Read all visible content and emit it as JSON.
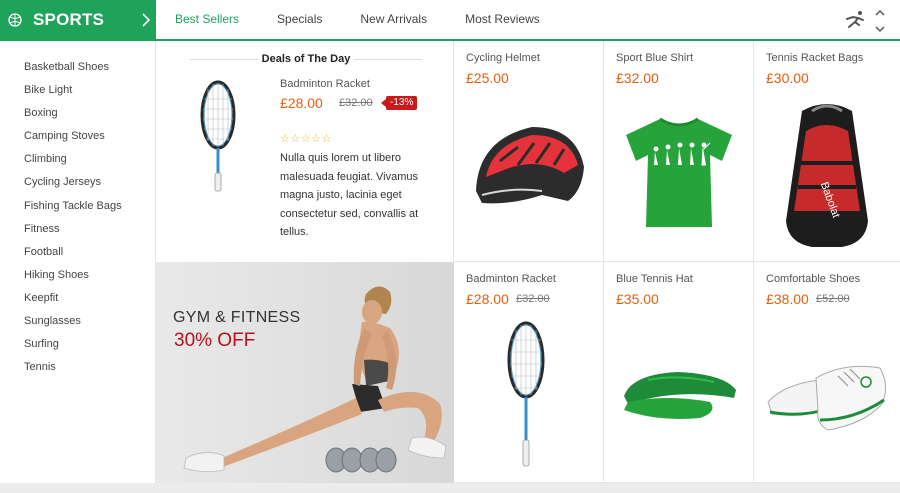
{
  "category": {
    "title": "SPORTS",
    "icon": "sports-ball-icon",
    "expand_icon": "chevron-right-icon"
  },
  "tabs": [
    {
      "label": "Best Sellers",
      "active": true
    },
    {
      "label": "Specials",
      "active": false
    },
    {
      "label": "New Arrivals",
      "active": false
    },
    {
      "label": "Most Reviews",
      "active": false
    }
  ],
  "header_icons": {
    "sport": "runner-icon",
    "nav": "up-down-arrows-icon"
  },
  "sidebar": {
    "items": [
      "Basketball Shoes",
      "Bike Light",
      "Boxing",
      "Camping Stoves",
      "Climbing",
      "Cycling Jerseys",
      "Fishing Tackle Bags",
      "Fitness",
      "Football",
      "Hiking Shoes",
      "Keepfit",
      "Sunglasses",
      "Surfing",
      "Tennis"
    ]
  },
  "deal": {
    "title": "Deals of The Day",
    "name": "Badminton Racket",
    "price": "£28.00",
    "old_price": "£32.00",
    "discount": "-13%",
    "rating": 0,
    "stars": "☆☆☆☆☆",
    "description": "Nulla quis lorem ut libero malesuada feugiat. Vivamus magna justo, lacinia eget consectetur sed, convallis at tellus."
  },
  "promo": {
    "line1": "GYM & FITNESS",
    "line2": "30% OFF"
  },
  "products": [
    {
      "name": "Cycling Helmet",
      "price": "£25.00",
      "old_price": "",
      "image": "helmet"
    },
    {
      "name": "Sport Blue Shirt",
      "price": "£32.00",
      "old_price": "",
      "image": "tshirt"
    },
    {
      "name": "Tennis Racket Bags",
      "price": "£30.00",
      "old_price": "",
      "image": "racket-bag"
    },
    {
      "name": "Badminton Racket",
      "price": "£28.00",
      "old_price": "£32.00",
      "image": "racket"
    },
    {
      "name": "Blue Tennis Hat",
      "price": "£35.00",
      "old_price": "",
      "image": "visor"
    },
    {
      "name": "Comfortable Shoes",
      "price": "£38.00",
      "old_price": "£52.00",
      "image": "shoes"
    }
  ],
  "colors": {
    "brand": "#1fa35b",
    "price": "#e85d0d",
    "badge": "#c81a1a",
    "promo_accent": "#b5121b"
  }
}
